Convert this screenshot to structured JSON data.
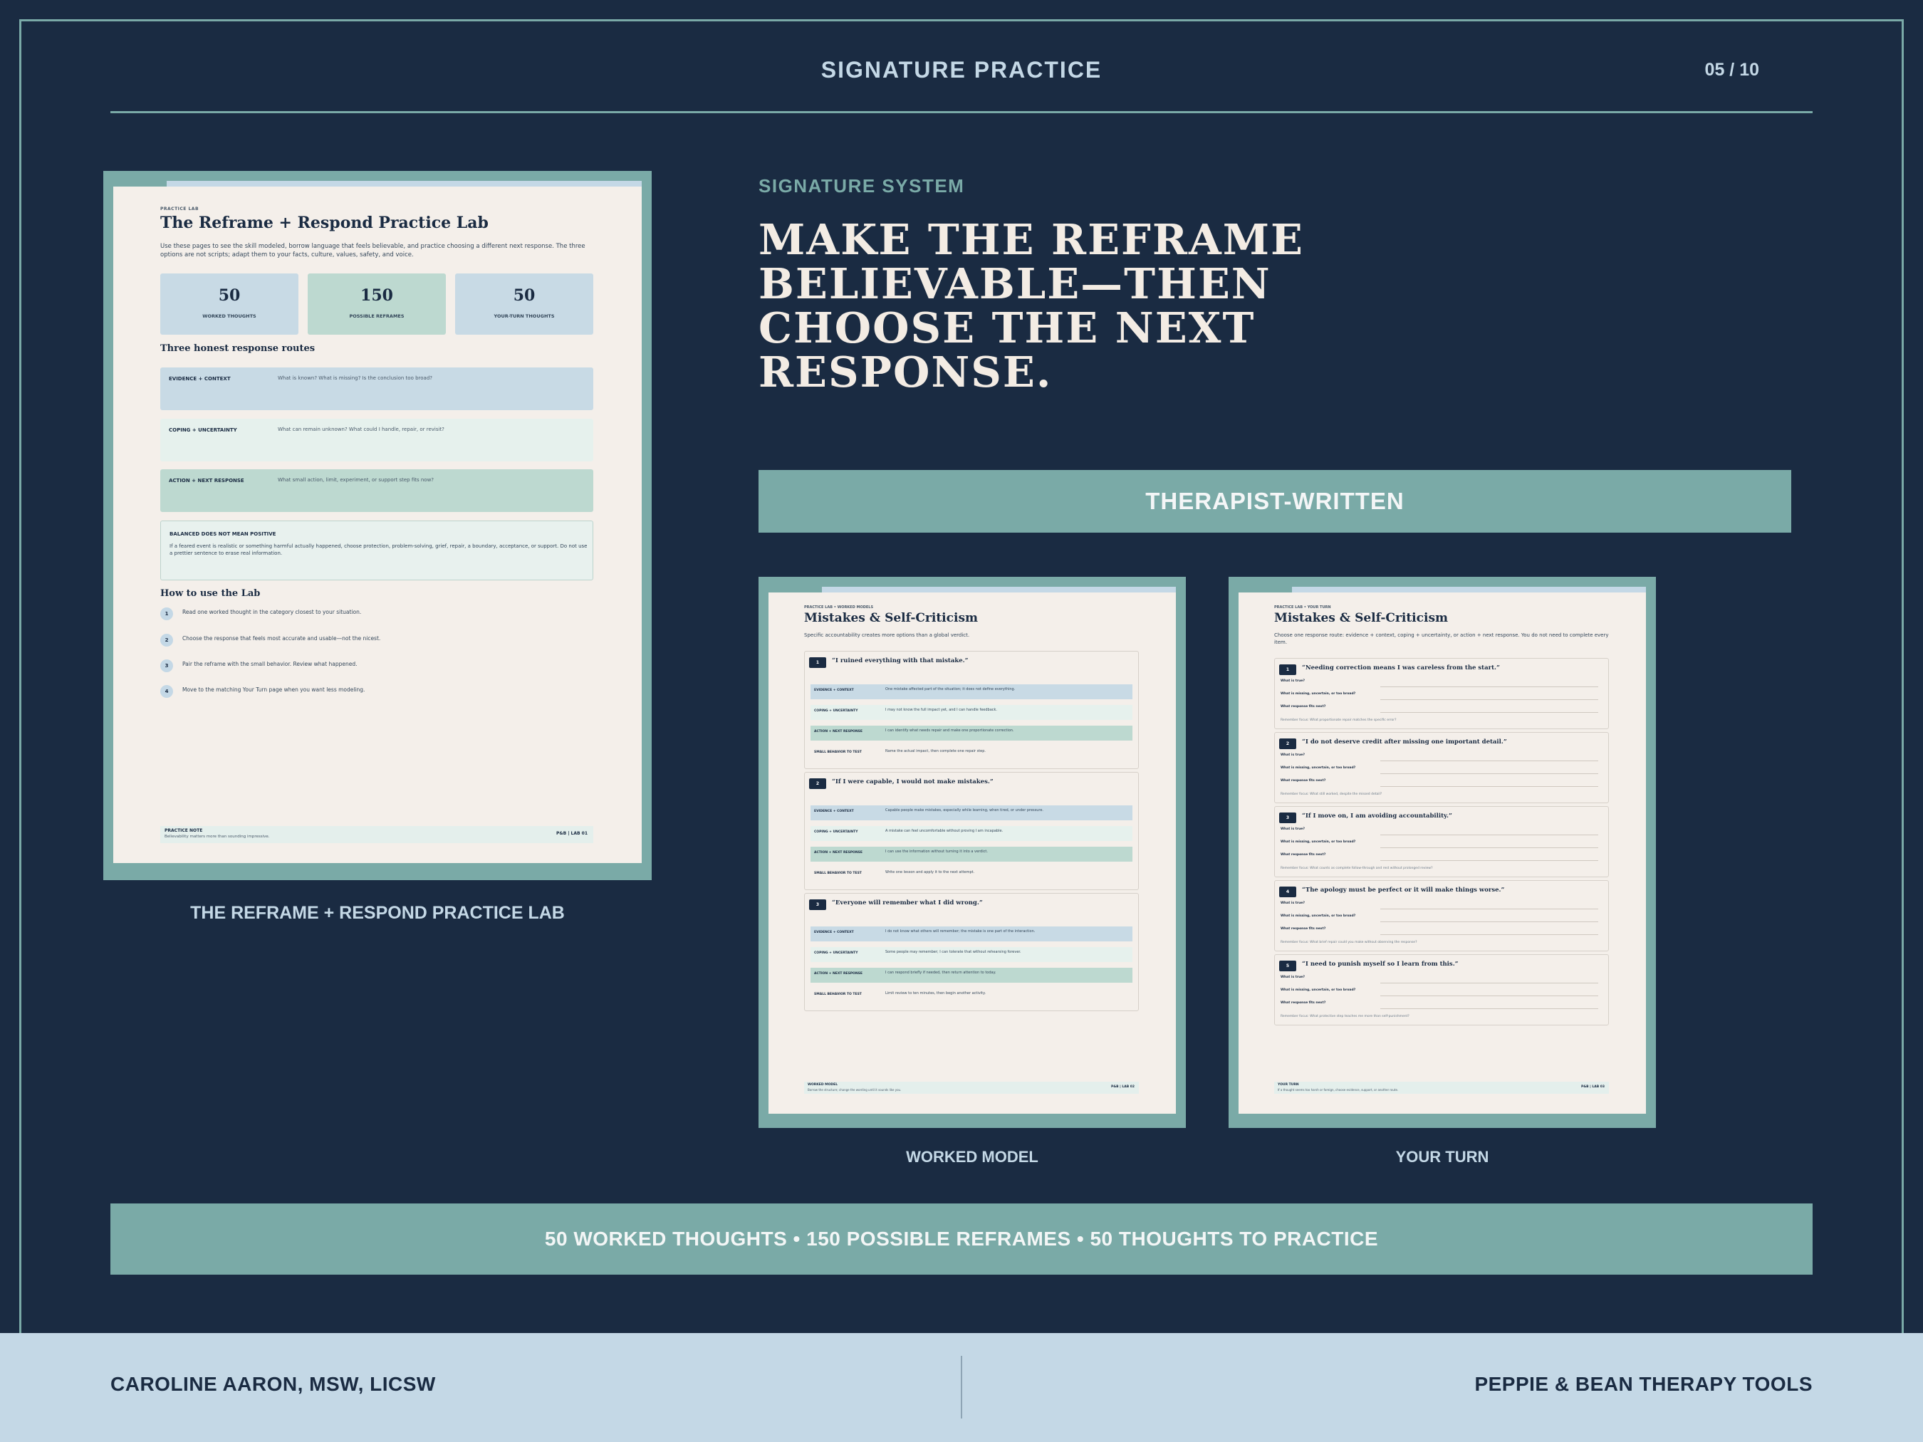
{
  "header": {
    "title": "SIGNATURE PRACTICE",
    "page": "05 / 10"
  },
  "left_doc": {
    "eyebrow": "PRACTICE LAB",
    "title": "The Reframe + Respond Practice Lab",
    "intro": "Use these pages to see the skill modeled, borrow language that feels believable, and practice choosing a different next response. The three options are not scripts; adapt them to your facts, culture, values, safety, and voice.",
    "stats": [
      {
        "num": "50",
        "label": "WORKED THOUGHTS"
      },
      {
        "num": "150",
        "label": "POSSIBLE REFRAMES"
      },
      {
        "num": "50",
        "label": "YOUR-TURN THOUGHTS"
      }
    ],
    "routes_title": "Three honest response routes",
    "routes": [
      {
        "name": "EVIDENCE + CONTEXT",
        "text": "What is known? What is missing? Is the conclusion too broad?"
      },
      {
        "name": "COPING + UNCERTAINTY",
        "text": "What can remain unknown? What could I handle, repair, or revisit?"
      },
      {
        "name": "ACTION + NEXT RESPONSE",
        "text": "What small action, limit, experiment, or support step fits now?"
      }
    ],
    "note_title": "BALANCED DOES NOT MEAN POSITIVE",
    "note_body": "If a feared event is realistic or something harmful actually happened, choose protection, problem-solving, grief, repair, a boundary, acceptance, or support. Do not use a prettier sentence to erase real information.",
    "how_title": "How to use the Lab",
    "steps": [
      {
        "n": "1",
        "text": "Read one worked thought in the category closest to your situation."
      },
      {
        "n": "2",
        "text": "Choose the response that feels most accurate and usable—not the nicest."
      },
      {
        "n": "3",
        "text": "Pair the reframe with the small behavior. Review what happened."
      },
      {
        "n": "4",
        "text": "Move to the matching Your Turn page when you want less modeling."
      }
    ],
    "footer_title": "PRACTICE NOTE",
    "footer_text": "Believability matters more than sounding impressive.",
    "footer_page": "P&B | LAB 01",
    "caption": "THE REFRAME + RESPOND PRACTICE LAB"
  },
  "eyebrow": "SIGNATURE SYSTEM",
  "headline": "MAKE THE REFRAME BELIEVABLE—THEN CHOOSE THE NEXT RESPONSE.",
  "badge": "THERAPIST-WRITTEN",
  "worked": {
    "eyebrow": "PRACTICE LAB • WORKED MODELS",
    "title": "Mistakes & Self-Criticism",
    "intro": "Specific accountability creates more options than a global verdict.",
    "labels": [
      "EVIDENCE + CONTEXT",
      "COPING + UNCERTAINTY",
      "ACTION + NEXT RESPONSE",
      "SMALL BEHAVIOR TO TEST"
    ],
    "cards": [
      {
        "n": "1",
        "quote": "“I ruined everything with that mistake.”",
        "rows": [
          "One mistake affected part of the situation; it does not define everything.",
          "I may not know the full impact yet, and I can handle feedback.",
          "I can identify what needs repair and make one proportionate correction.",
          "Name the actual impact, then complete one repair step."
        ]
      },
      {
        "n": "2",
        "quote": "“If I were capable, I would not make mistakes.”",
        "rows": [
          "Capable people make mistakes, especially while learning, when tired, or under pressure.",
          "A mistake can feel uncomfortable without proving I am incapable.",
          "I can use the information without turning it into a verdict.",
          "Write one lesson and apply it to the next attempt."
        ]
      },
      {
        "n": "3",
        "quote": "“Everyone will remember what I did wrong.”",
        "rows": [
          "I do not know what others will remember; the mistake is one part of the interaction.",
          "Some people may remember; I can tolerate that without rehearsing forever.",
          "I can respond briefly if needed, then return attention to today.",
          "Limit review to ten minutes, then begin another activity."
        ]
      }
    ],
    "footer_title": "WORKED MODEL",
    "footer_text": "Borrow the structure; change the wording until it sounds like you.",
    "footer_page": "P&B | LAB 02",
    "caption": "WORKED MODEL"
  },
  "yourturn": {
    "eyebrow": "PRACTICE LAB • YOUR TURN",
    "title": "Mistakes & Self-Criticism",
    "intro": "Choose one response route: evidence + context, coping + uncertainty, or action + next response. You do not need to complete every item.",
    "labels": [
      "What is true?",
      "What is missing, uncertain, or too broad?",
      "What response fits next?"
    ],
    "cards": [
      {
        "n": "1",
        "quote": "“Needing correction means I was careless from the start.”",
        "remember": "Remember focus: What proportionate repair matches the specific error?"
      },
      {
        "n": "2",
        "quote": "“I do not deserve credit after missing one important detail.”",
        "remember": "Remember focus: What still worked, despite the missed detail?"
      },
      {
        "n": "3",
        "quote": "“If I move on, I am avoiding accountability.”",
        "remember": "Remember focus: What counts as complete follow-through and rest without prolonged review?"
      },
      {
        "n": "4",
        "quote": "“The apology must be perfect or it will make things worse.”",
        "remember": "Remember focus: What brief repair could you make without observing the response?"
      },
      {
        "n": "5",
        "quote": "“I need to punish myself so I learn from this.”",
        "remember": "Remember focus: What protective step teaches me more than self-punishment?"
      }
    ],
    "footer_title": "YOUR TURN",
    "footer_text": "If a thought seems too harsh or foreign, choose evidence, support, or another route.",
    "footer_page": "P&B | LAB 03",
    "caption": "YOUR TURN"
  },
  "band": "50 WORKED THOUGHTS • 150 POSSIBLE REFRAMES • 50 THOUGHTS TO PRACTICE",
  "footer": {
    "left": "CAROLINE AARON, MSW, LICSW",
    "right": "PEPPIE & BEAN THERAPY TOOLS"
  },
  "colors": {
    "navy": "#1a2b42",
    "teal": "#7aaaa7",
    "light_blue": "#c4d8e6",
    "cream": "#f3ece4"
  }
}
